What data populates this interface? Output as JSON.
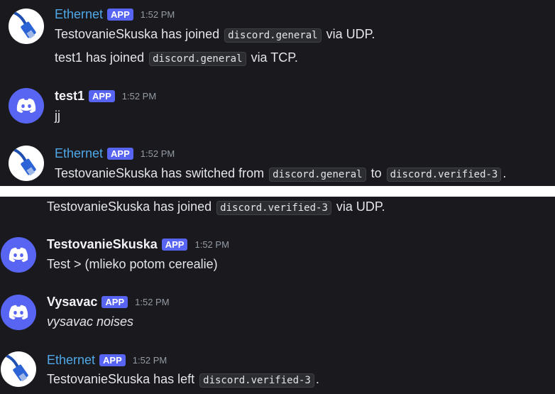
{
  "top": {
    "msg1": {
      "username": "Ethernet",
      "badge": "APP",
      "time": "1:52 PM",
      "line1": {
        "text": "TestovanieSkuska has joined",
        "code": "discord.general",
        "suffix": "via UDP."
      },
      "line2": {
        "text": "test1 has joined",
        "code": "discord.general",
        "suffix": "via TCP."
      }
    },
    "msg2": {
      "username": "test1",
      "badge": "APP",
      "time": "1:52 PM",
      "text": "jj"
    },
    "msg3": {
      "username": "Ethernet",
      "badge": "APP",
      "time": "1:52 PM",
      "line": {
        "text": "TestovanieSkuska has switched from",
        "code1": "discord.general",
        "mid": "to",
        "code2": "discord.verified-3",
        "suffix": "."
      }
    }
  },
  "bottom": {
    "cont": {
      "text": "TestovanieSkuska has joined",
      "code": "discord.verified-3",
      "suffix": "via UDP."
    },
    "msg1": {
      "username": "TestovanieSkuska",
      "badge": "APP",
      "time": "1:52 PM",
      "text": "Test > (mlieko potom cerealie)"
    },
    "msg2": {
      "username": "Vysavac",
      "badge": "APP",
      "time": "1:52 PM",
      "text": "vysavac noises"
    },
    "msg3": {
      "username": "Ethernet",
      "badge": "APP",
      "time": "1:52 PM",
      "line": {
        "text": "TestovanieSkuska has left",
        "code": "discord.verified-3",
        "suffix": "."
      }
    }
  },
  "colors": {
    "background": "#1a1a1e",
    "accent": "#5865f2",
    "ethernet_name": "#4fa8e8",
    "timestamp": "#949ba4"
  },
  "icons": {
    "ethernet_avatar": "ethernet-cable-icon",
    "bot_avatar": "discord-logo-icon"
  }
}
